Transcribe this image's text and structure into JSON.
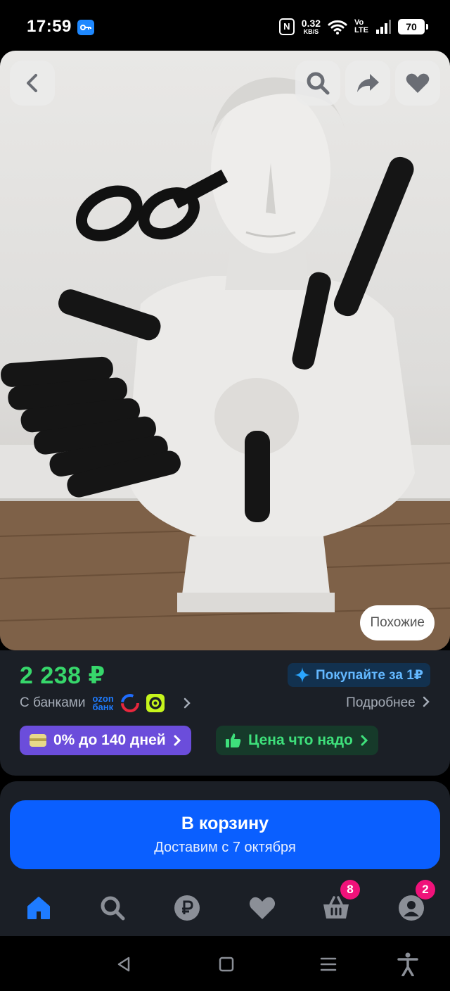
{
  "status_bar": {
    "time": "17:59",
    "net_speed_value": "0.32",
    "net_speed_unit": "KB/S",
    "volte_top": "Vo",
    "volte_bottom": "LTE",
    "battery": "70",
    "nfc": "N"
  },
  "image": {
    "similar_label": "Похожие"
  },
  "product": {
    "price": "2 238 ₽",
    "promo_label": "Покупайте за 1₽",
    "banks_label": "С банками",
    "ozon_bank_line1": "ozon",
    "ozon_bank_line2": "банк",
    "details_label": "Подробнее",
    "installment_label": "0% до 140 дней",
    "good_price_label": "Цена что надо"
  },
  "cart": {
    "title": "В корзину",
    "subtitle": "Доставим с 7 октября"
  },
  "tabbar": {
    "cart_badge": "8",
    "profile_badge": "2"
  },
  "colors": {
    "price": "#37d76b",
    "accent_blue": "#0a5fff",
    "installment": "#6b4ddb",
    "badge": "#f0127a"
  }
}
